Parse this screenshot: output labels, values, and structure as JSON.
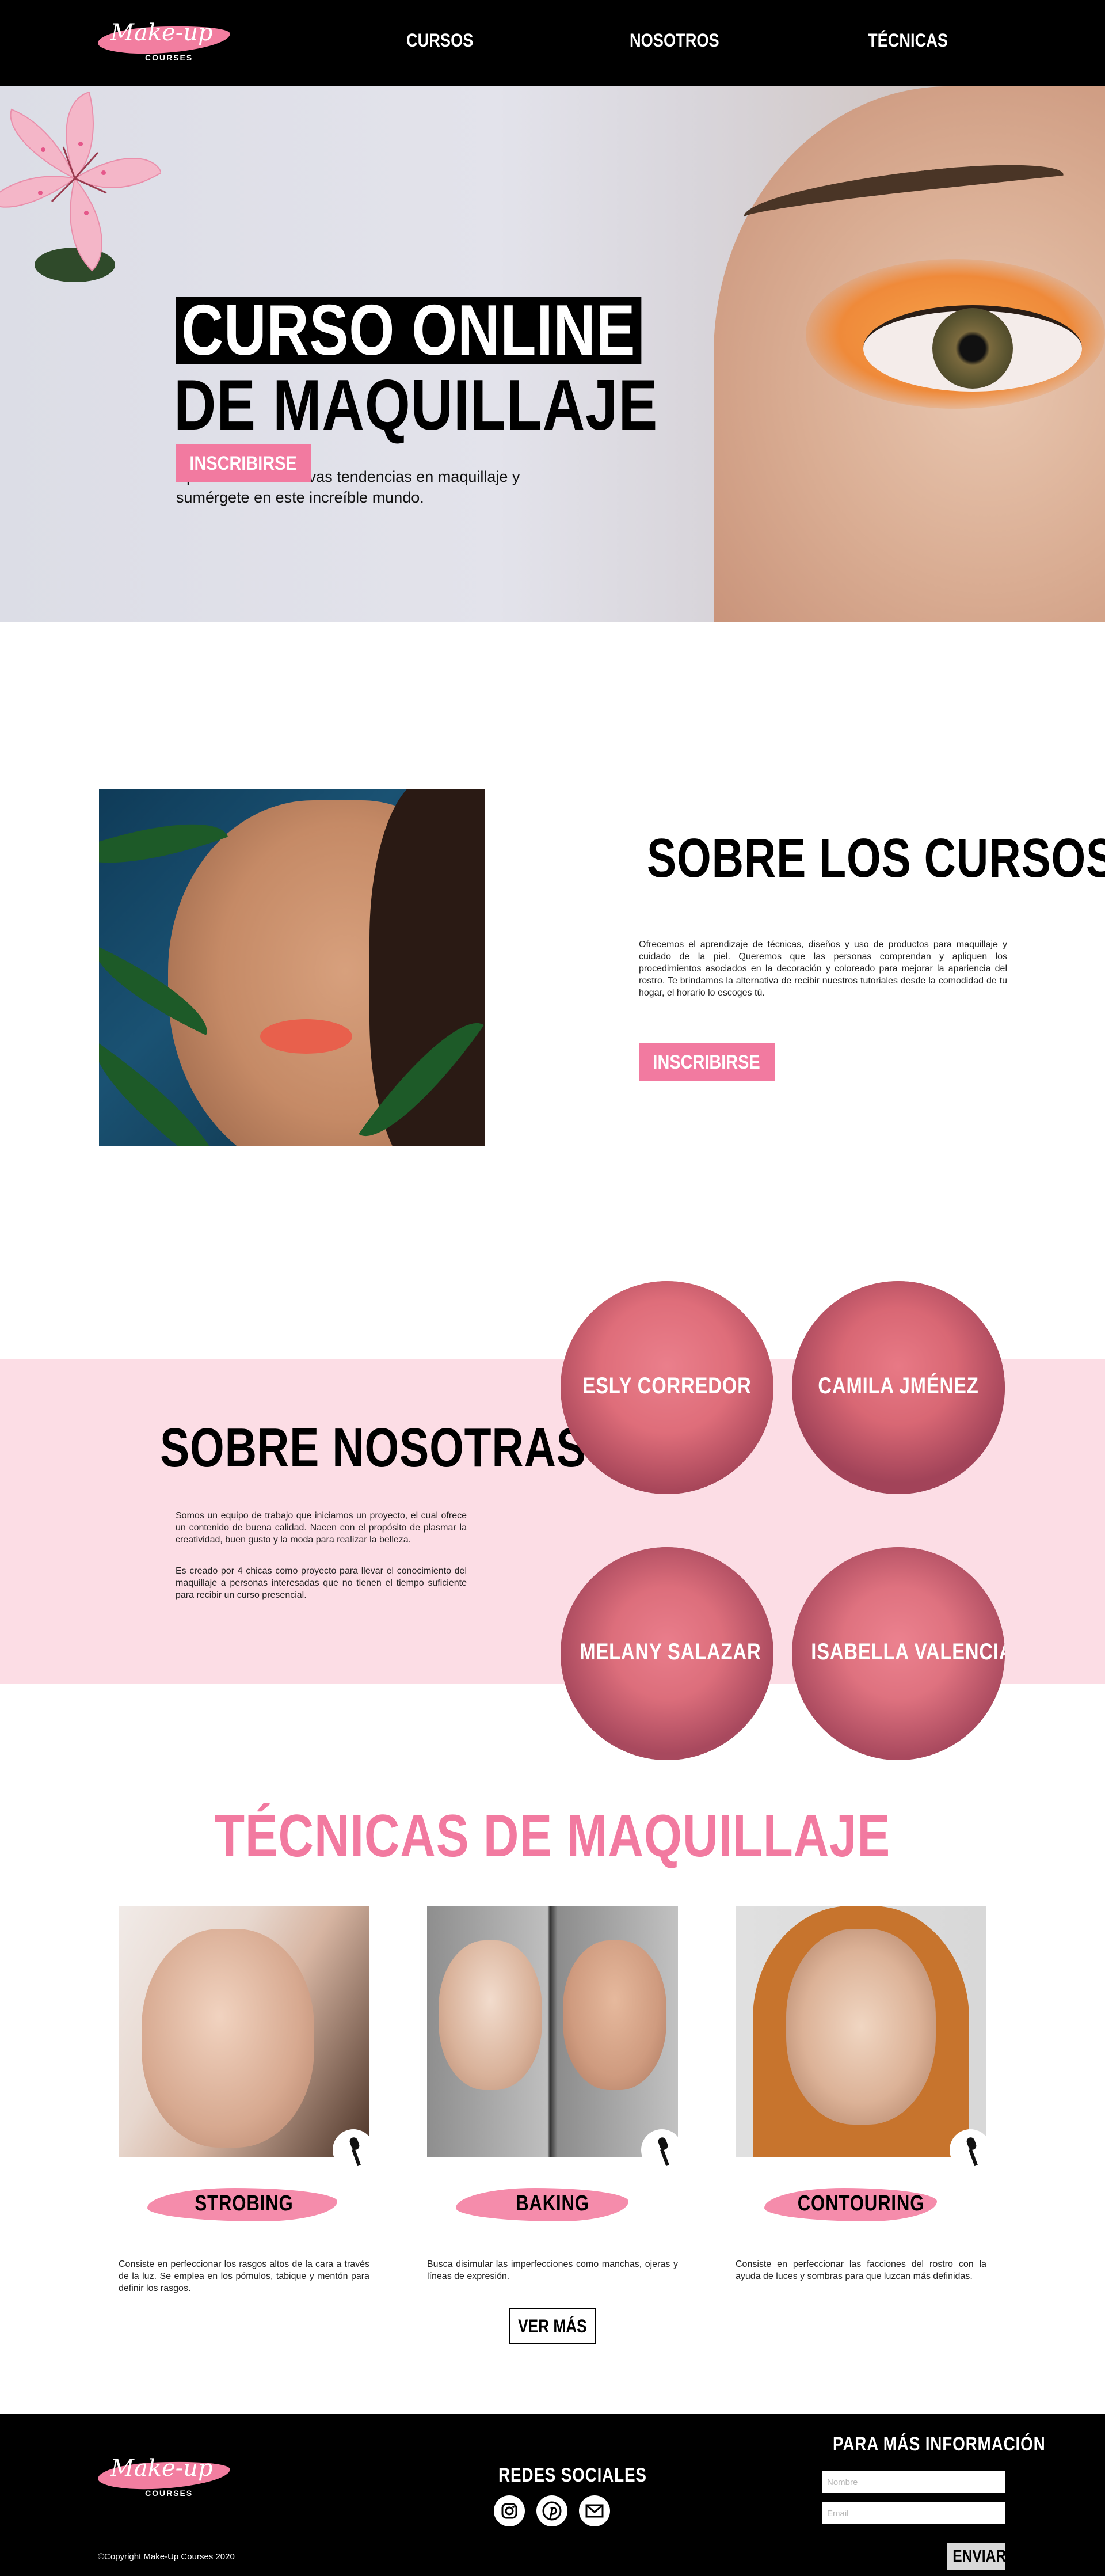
{
  "brand": {
    "logo_script": "Make-up",
    "logo_sub": "COURSES"
  },
  "nav": {
    "items": [
      {
        "label": "CURSOS"
      },
      {
        "label": "NOSOTROS"
      },
      {
        "label": "TÉCNICAS"
      }
    ]
  },
  "hero": {
    "title_line1": "CURSO ONLINE",
    "title_line2": "DE MAQUILLAJE",
    "description": "Aprende sobre nuevas tendencias en maquillaje y sumérgete en este increíble mundo.",
    "cta_label": "INSCRIBIRSE"
  },
  "cursos": {
    "title": "SOBRE LOS CURSOS",
    "body": "Ofrecemos el aprendizaje de técnicas, diseños y uso de productos para maquillaje y cuidado de la piel. Queremos que las personas comprendan y apliquen los procedimientos asociados en la decoración y coloreado para mejorar la apariencia del rostro. Te brindamos la alternativa de recibir nuestros tutoriales desde la comodidad de tu hogar, el horario lo escoges tú.",
    "cta_label": "INSCRIBIRSE"
  },
  "nosotras": {
    "title": "SOBRE NOSOTRAS",
    "paragraph1": "Somos un equipo de trabajo que iniciamos un proyecto, el cual ofrece un contenido de buena calidad. Nacen con el propósito de plasmar la creatividad, buen gusto y la moda para realizar la belleza.",
    "paragraph2": "Es creado por 4 chicas como proyecto para llevar el conocimiento del maquillaje a personas interesadas que no tienen el tiempo suficiente para recibir un curso presencial.",
    "members": [
      {
        "name": "ESLY CORREDOR"
      },
      {
        "name": "CAMILA JMÉNEZ"
      },
      {
        "name": "MELANY SALAZAR"
      },
      {
        "name": "ISABELLA VALENCIA"
      }
    ]
  },
  "tecnicas": {
    "title": "TÉCNICAS DE MAQUILLAJE",
    "items": [
      {
        "label": "STROBING",
        "description": "Consiste en perfeccionar los rasgos altos de la cara a través de la luz. Se emplea en los pómulos, tabique y mentón para definir los rasgos."
      },
      {
        "label": "BAKING",
        "description": "Busca disimular las imperfecciones como manchas, ojeras y líneas de expresión."
      },
      {
        "label": "CONTOURING",
        "description": "Consiste en perfeccionar las facciones del rostro con la ayuda de luces y sombras  para que luzcan más definidas."
      }
    ],
    "more_label": "VER MÁS"
  },
  "footer": {
    "social_title": "REDES SOCIALES",
    "info_title": "PARA MÁS INFORMACIÓN",
    "name_placeholder": "Nombre",
    "email_placeholder": "Email",
    "send_label": "ENVIAR",
    "copyright": "©Copyright Make-Up Courses 2020"
  },
  "colors": {
    "accent": "#f27aa0",
    "band": "#fcdde5",
    "dark": "#000000"
  }
}
